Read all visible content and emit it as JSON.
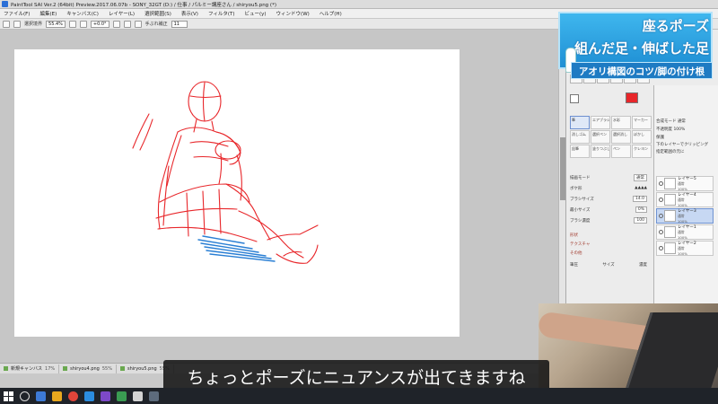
{
  "window": {
    "title": "PaintTool SAI Ver.2 (64bit) Preview.2017.06.07b - SONY_32GT (D:) / 仕事 / パルミー講座さん / shiryou5.png (*)"
  },
  "menu": [
    "ファイル(F)",
    "編集(E)",
    "キャンバス(C)",
    "レイヤー(L)",
    "選択範囲(S)",
    "表示(V)",
    "フィルタ(T)",
    "ビュー(y)",
    "ウィンドウ(W)",
    "ヘルプ(H)"
  ],
  "toolbar": {
    "select_label": "選択境界",
    "zoom": "55.4%",
    "angle": "+0.0°",
    "stabilizer_label": "手ぶれ補正",
    "stabilizer_value": "11"
  },
  "tool_panel": {
    "brushes": [
      "筆",
      "エアブラシ",
      "水彩",
      "マーカー",
      "消しゴム",
      "選択ペン",
      "選択消し",
      "ぼかし",
      "鉛筆",
      "塗りつぶし",
      "ペン",
      "クレヨン"
    ],
    "blend_mode_label": "描画モード",
    "blend_mode": "通常",
    "brush_shape_label": "ボケ形",
    "brush_size_label": "ブラシサイズ",
    "brush_size": "14.0",
    "min_size_label": "最小サイズ",
    "min_size": "0%",
    "density_label": "ブラシ濃度",
    "density": "100",
    "sec_shape": "形状",
    "sec_texture": "テクスチャ",
    "sec_blend": "その他",
    "pressure_label": "筆圧",
    "pressure_size": "サイズ",
    "pressure_density": "濃度"
  },
  "layer_panel": {
    "blend_label": "合成モード",
    "blend": "通常",
    "opacity_label": "不透明度",
    "opacity": "100%",
    "protect_label": "保護",
    "clip_label": "下のレイヤーでクリッピング",
    "select_src_label": "指定範囲の元に",
    "layers": [
      {
        "name": "レイヤー5",
        "mode": "通常",
        "opacity": "100%"
      },
      {
        "name": "レイヤー4",
        "mode": "通常",
        "opacity": "100%"
      },
      {
        "name": "レイヤー3",
        "mode": "通常",
        "opacity": "100%"
      },
      {
        "name": "レイヤー1",
        "mode": "通常",
        "opacity": "100%"
      },
      {
        "name": "レイヤー2",
        "mode": "通常",
        "opacity": "100%"
      }
    ]
  },
  "doc_tabs": [
    {
      "name": "新規キャンバス",
      "zoom": "17%"
    },
    {
      "name": "shiryou4.png",
      "zoom": "55%"
    },
    {
      "name": "shiryou5.png",
      "zoom": "55%"
    }
  ],
  "banner": {
    "line1": "座るポーズ",
    "line2": "組んだ足・伸ばした足",
    "line3": "アオリ構図のコツ/脚の付け根"
  },
  "subtitle": "ちょっとポーズにニュアンスが出てきますね",
  "colors": {
    "sketch_red": "#e8262a",
    "sketch_blue": "#2a7fd4",
    "banner_blue": "#3fb7ee"
  }
}
